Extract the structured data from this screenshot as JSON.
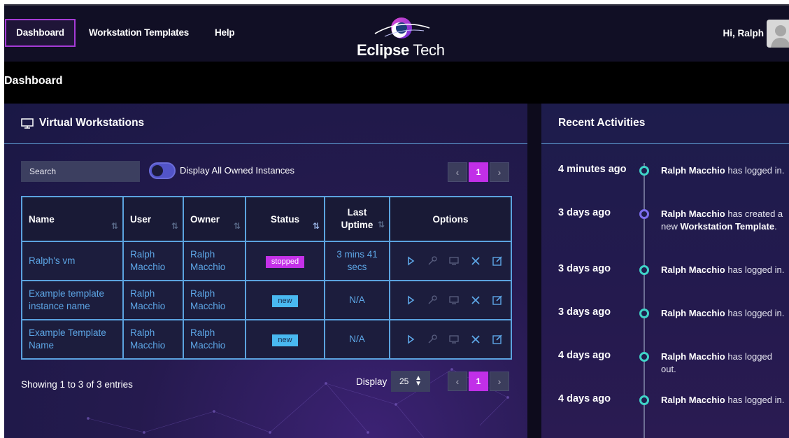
{
  "nav": {
    "items": [
      "Dashboard",
      "Workstation Templates",
      "Help"
    ],
    "logo_bold": "Eclipse",
    "logo_light": " Tech",
    "greeting": "Hi, Ralph"
  },
  "page": {
    "title": "Dashboard"
  },
  "workstations": {
    "title": "Virtual Workstations",
    "search_placeholder": "Search",
    "toggle_label": "Display All Owned Instances",
    "page_prev": "‹",
    "page_current": "1",
    "page_next": "›",
    "columns": [
      "Name",
      "User",
      "Owner",
      "Status",
      "Last Uptime",
      "Options"
    ],
    "rows": [
      {
        "name": "Ralph's vm",
        "user": "Ralph Macchio",
        "owner": "Ralph Macchio",
        "status": "stopped",
        "uptime": "3 mins 41 secs"
      },
      {
        "name": "Example template instance name",
        "user": "Ralph Macchio",
        "owner": "Ralph Macchio",
        "status": "new",
        "uptime": "N/A"
      },
      {
        "name": "Example Template Name",
        "user": "Ralph Macchio",
        "owner": "Ralph Macchio",
        "status": "new",
        "uptime": "N/A"
      }
    ],
    "entries_text": "Showing 1 to 3 of 3 entries",
    "display_label": "Display",
    "display_value": "25"
  },
  "activities": {
    "title": "Recent Activities",
    "items": [
      {
        "time": "4 minutes ago",
        "user": "Ralph Macchio",
        "text": " has logged in.",
        "bold_tail": "",
        "tail": "",
        "color": "teal"
      },
      {
        "time": "3 days ago",
        "user": "Ralph Macchio",
        "text": " has created a new ",
        "bold_tail": "Workstation Template",
        "tail": ".",
        "color": "purple"
      },
      {
        "time": "3 days ago",
        "user": "Ralph Macchio",
        "text": " has logged in.",
        "bold_tail": "",
        "tail": "",
        "color": "teal"
      },
      {
        "time": "3 days ago",
        "user": "Ralph Macchio",
        "text": " has logged in.",
        "bold_tail": "",
        "tail": "",
        "color": "teal"
      },
      {
        "time": "4 days ago",
        "user": "Ralph Macchio",
        "text": " has logged out.",
        "bold_tail": "",
        "tail": "",
        "color": "teal"
      },
      {
        "time": "4 days ago",
        "user": "Ralph Macchio",
        "text": " has logged in.",
        "bold_tail": "",
        "tail": "",
        "color": "teal"
      }
    ]
  },
  "colors": {
    "accent": "#c12fe8",
    "table_border": "#5ba3df",
    "link": "#5da6e6",
    "badge_new": "#49b8f0"
  }
}
